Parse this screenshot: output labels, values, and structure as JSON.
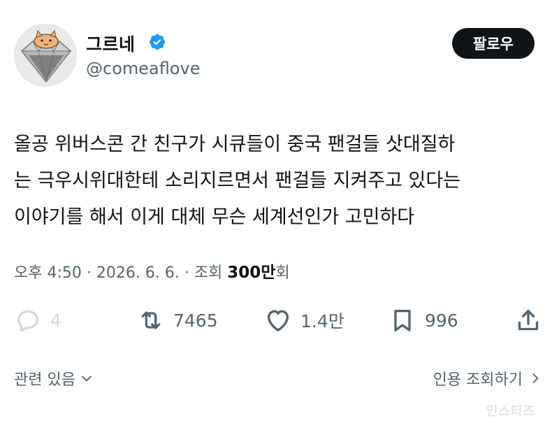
{
  "author": {
    "display_name": "그르네",
    "handle": "@comeaflove",
    "verified": true,
    "avatar_icon": "diamond-cat-avatar"
  },
  "follow_button": {
    "label": "팔로우"
  },
  "tweet": {
    "text": "올공 위버스콘 간 친구가 시큐들이 중국 팬걸들 삿대질하\n는 극우시위대한테 소리지르면서 팬걸들 지켜주고 있다는\n이야기를 해서 이게 대체 무슨 세계선인가 고민하다"
  },
  "meta": {
    "time": "오후 4:50",
    "separator": " · ",
    "date": "2026. 6. 6.",
    "views_prefix": "조회 ",
    "views_count": "300만",
    "views_suffix": "회"
  },
  "actions": {
    "reply_count": "4",
    "retweet_count": "7465",
    "like_count": "1.4만",
    "bookmark_count": "996",
    "reply_icon": "reply-icon",
    "retweet_icon": "retweet-icon",
    "like_icon": "heart-icon",
    "bookmark_icon": "bookmark-icon",
    "share_icon": "share-icon"
  },
  "footer": {
    "related_label": "관련 있음",
    "quote_views_label": "인용 조회하기"
  },
  "watermark": "인스티즈",
  "colors": {
    "text": "#0f1419",
    "secondary": "#536471",
    "verified_blue": "#1d9bf0",
    "button_bg": "#0f1419",
    "disabled": "#cfd9de"
  }
}
